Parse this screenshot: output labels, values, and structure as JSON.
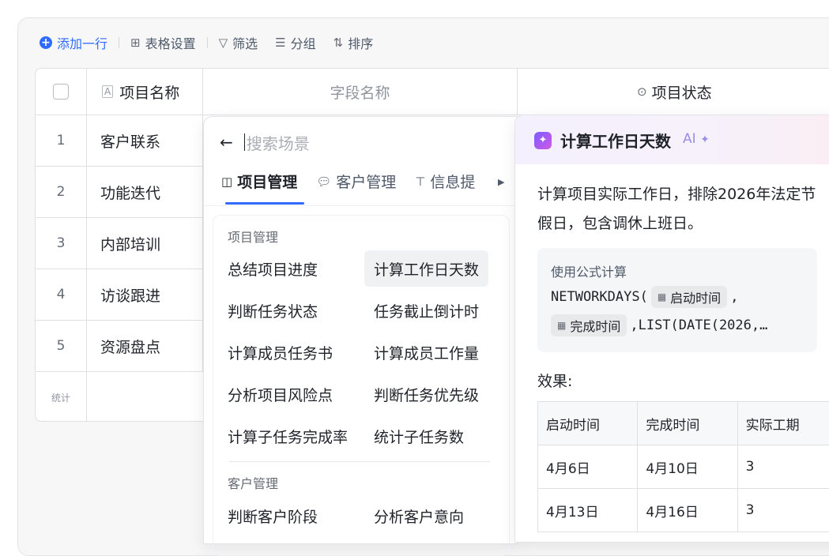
{
  "toolbar": {
    "add_row": "添加一行",
    "table_settings": "表格设置",
    "filter": "筛选",
    "group": "分组",
    "sort": "排序"
  },
  "table": {
    "columns": [
      "项目名称",
      "字段名称",
      "项目状态"
    ],
    "rows": [
      {
        "num": "1",
        "name": "客户联系"
      },
      {
        "num": "2",
        "name": "功能迭代"
      },
      {
        "num": "3",
        "name": "内部培训"
      },
      {
        "num": "4",
        "name": "访谈跟进"
      },
      {
        "num": "5",
        "name": "资源盘点"
      }
    ],
    "stat_label": "统计"
  },
  "scene_panel": {
    "search_placeholder": "搜索场景",
    "tabs": [
      "项目管理",
      "客户管理",
      "信息提"
    ],
    "sections": [
      {
        "title": "项目管理",
        "options": [
          "总结项目进度",
          "计算工作日天数",
          "判断任务状态",
          "任务截止倒计时",
          "计算成员任务书",
          "计算成员工作量",
          "分析项目风险点",
          "判断任务优先级",
          "计算子任务完成率",
          "统计子任务数"
        ]
      },
      {
        "title": "客户管理",
        "options": [
          "判断客户阶段",
          "分析客户意向"
        ]
      }
    ],
    "highlighted_option": "计算工作日天数"
  },
  "ai_panel": {
    "title": "计算工作日天数",
    "tag": "AI",
    "description": "计算项目实际工作日，排除2026年法定节假日，包含调休上班日。",
    "formula_label": "使用公式计算",
    "formula_fn": "NETWORKDAYS(",
    "formula_field1": "启动时间",
    "formula_comma": ",",
    "formula_field2": "完成时间",
    "formula_tail": ",LIST(DATE(2026,…",
    "effect_label": "效果:",
    "result_headers": [
      "启动时间",
      "完成时间",
      "实际工期"
    ],
    "result_rows": [
      [
        "4月6日",
        "4月10日",
        "3"
      ],
      [
        "4月13日",
        "4月16日",
        "3"
      ]
    ]
  },
  "colors": {
    "accent": "#2f6bff",
    "ai_gradient_start": "#7b5cff",
    "ai_gradient_end": "#d05ae6"
  }
}
